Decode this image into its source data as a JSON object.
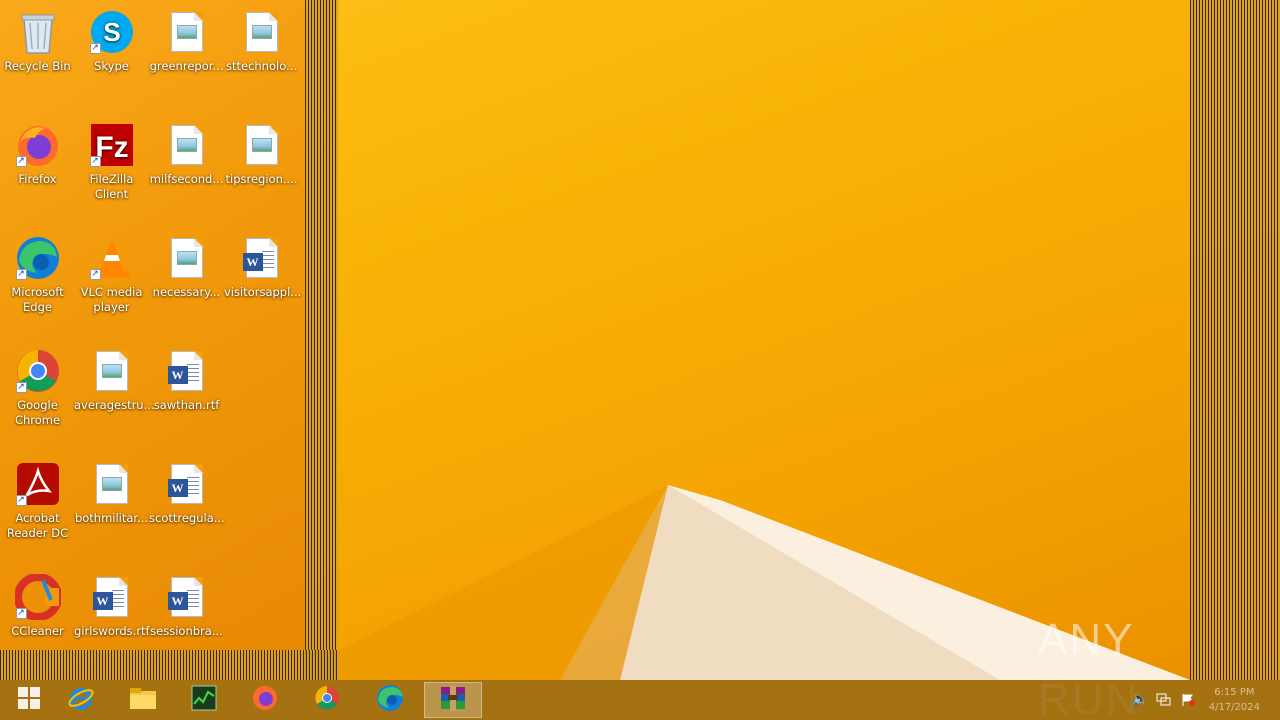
{
  "desktop": {
    "icons": [
      {
        "name": "recycle-bin",
        "label": "Recycle Bin",
        "icon": "recycle-bin-icon"
      },
      {
        "name": "skype",
        "label": "Skype",
        "icon": "skype-icon"
      },
      {
        "name": "greenrepor",
        "label": "greenrepor...",
        "icon": "image-file-icon"
      },
      {
        "name": "sttechnolo",
        "label": "sttechnolo...",
        "icon": "image-file-icon"
      },
      {
        "name": "firefox",
        "label": "Firefox",
        "icon": "firefox-icon"
      },
      {
        "name": "filezilla",
        "label": "FileZilla Client",
        "icon": "filezilla-icon"
      },
      {
        "name": "milfsecond",
        "label": "milfsecond...",
        "icon": "image-file-icon"
      },
      {
        "name": "tipsregion",
        "label": "tipsregion....",
        "icon": "image-file-icon"
      },
      {
        "name": "edge",
        "label": "Microsoft Edge",
        "icon": "edge-icon"
      },
      {
        "name": "vlc",
        "label": "VLC media player",
        "icon": "vlc-icon"
      },
      {
        "name": "necessary",
        "label": "necessary...",
        "icon": "image-file-icon"
      },
      {
        "name": "visitorsappl",
        "label": "visitorsappl...",
        "icon": "word-doc-icon"
      },
      {
        "name": "chrome",
        "label": "Google Chrome",
        "icon": "chrome-icon"
      },
      {
        "name": "averagestru",
        "label": "averagestru...",
        "icon": "image-file-icon"
      },
      {
        "name": "sawthan",
        "label": "sawthan.rtf",
        "icon": "word-doc-icon"
      },
      {
        "name": "acrobat",
        "label": "Acrobat Reader DC",
        "icon": "acrobat-icon"
      },
      {
        "name": "bothmilitar",
        "label": "bothmilitar...",
        "icon": "image-file-icon"
      },
      {
        "name": "scottregula",
        "label": "scottregula...",
        "icon": "word-doc-icon"
      },
      {
        "name": "ccleaner",
        "label": "CCleaner",
        "icon": "ccleaner-icon"
      },
      {
        "name": "girlswords",
        "label": "girlswords.rtf",
        "icon": "word-doc-icon"
      },
      {
        "name": "sessionbra",
        "label": "sessionbra...",
        "icon": "word-doc-icon"
      }
    ]
  },
  "taskbar": {
    "buttons": [
      {
        "name": "start",
        "icon": "start-icon"
      },
      {
        "name": "internet-explorer",
        "icon": "internet-explorer-icon"
      },
      {
        "name": "file-explorer",
        "icon": "folder-icon"
      },
      {
        "name": "task-manager",
        "icon": "task-manager-icon"
      },
      {
        "name": "firefox",
        "icon": "firefox-icon"
      },
      {
        "name": "chrome",
        "icon": "chrome-icon"
      },
      {
        "name": "edge",
        "icon": "edge-icon"
      },
      {
        "name": "winrar",
        "icon": "winrar-icon",
        "active": true
      }
    ],
    "tray": {
      "icons": [
        "volume-icon",
        "network-icon",
        "action-center-flag-icon"
      ],
      "time": "6:15 PM",
      "date": "4/17/2024"
    }
  },
  "watermark": {
    "text": "ANY RUN"
  },
  "colors": {
    "wallpaper": "#f5a800",
    "word_blue": "#2b579a",
    "taskbar": "#966914"
  }
}
